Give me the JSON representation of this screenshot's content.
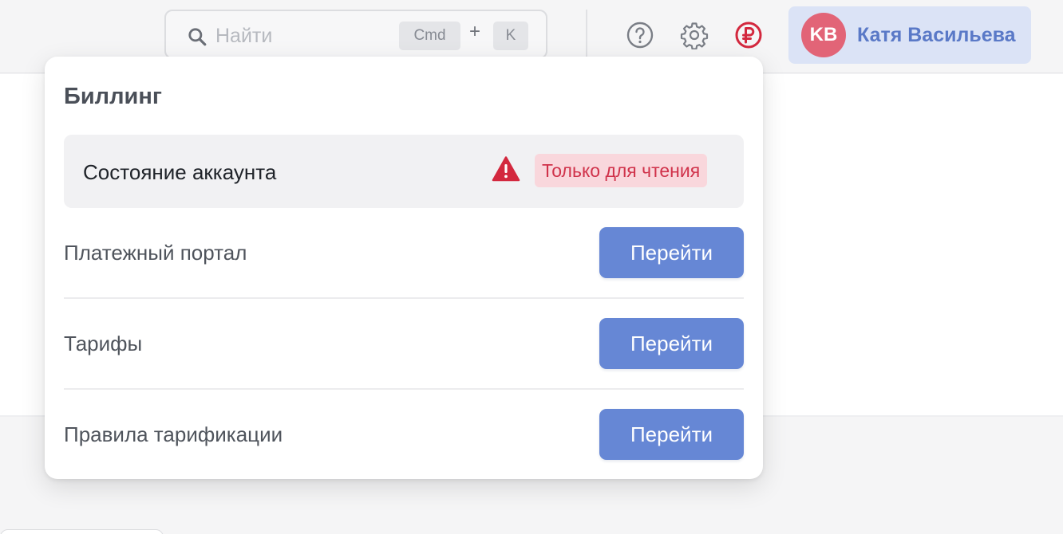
{
  "search": {
    "placeholder": "Найти",
    "shortcut_modifier": "Cmd",
    "shortcut_plus": "+",
    "shortcut_key": "K",
    "icon": "search-icon"
  },
  "header": {
    "icons": [
      "help-circle-icon",
      "gear-icon",
      "ruble-circle-icon"
    ],
    "alert_color": "#d3283e"
  },
  "user": {
    "initials": "KB",
    "name": "Катя Васильева",
    "avatar_color": "#e26477"
  },
  "billing_menu": {
    "title": "Биллинг",
    "account_status": {
      "label": "Состояние аккаунта",
      "icon": "warning-triangle-icon",
      "badge": "Только для чтения",
      "badge_color": "#d0324a"
    },
    "items": [
      {
        "label": "Платежный портал",
        "button": "Перейти"
      },
      {
        "label": "Тарифы",
        "button": "Перейти"
      },
      {
        "label": "Правила тарификации",
        "button": "Перейти"
      }
    ],
    "button_color": "#6687d5"
  }
}
